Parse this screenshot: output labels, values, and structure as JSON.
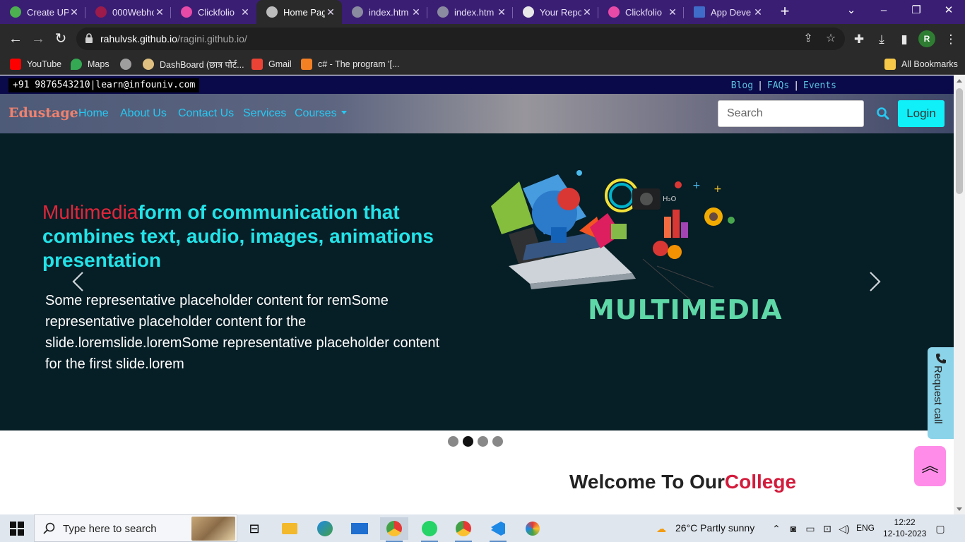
{
  "browser": {
    "tabs": [
      {
        "label": "Create UP",
        "color": "#4caf50"
      },
      {
        "label": "000Webho",
        "color": "#9c1b4a"
      },
      {
        "label": "Clickfolio",
        "color": "#e84aa8"
      },
      {
        "label": "Home Pag",
        "color": "#bdbdbd",
        "active": true
      },
      {
        "label": "index.htm",
        "color": "#8a8aa0"
      },
      {
        "label": "index.htm",
        "color": "#8a8aa0"
      },
      {
        "label": "Your Repo",
        "color": "#e8e8e8"
      },
      {
        "label": "Clickfolio",
        "color": "#e84aa8"
      },
      {
        "label": "App Deve",
        "color": "#3e6cc8"
      }
    ],
    "url_host": "rahulvsk.github.io",
    "url_path": "/ragini.github.io/",
    "profile_initial": "R",
    "bookmarks": [
      {
        "label": "YouTube",
        "color": "#ff0000"
      },
      {
        "label": "Maps",
        "color": "#34a853"
      },
      {
        "label": "",
        "color": "#9e9e9e"
      },
      {
        "label": "DashBoard (छात्र पोर्ट...",
        "color": "#e0c080"
      },
      {
        "label": "Gmail",
        "color": "#ea4335"
      },
      {
        "label": "c# - The program '[...",
        "color": "#f48024"
      }
    ],
    "all_bookmarks": "All Bookmarks"
  },
  "site": {
    "contact": "+91 9876543210|learn@infouniv.com",
    "top_links": [
      "Blog",
      "FAQs",
      "Events"
    ],
    "brand": "Edustage",
    "nav": [
      "Home",
      "About Us",
      "Contact Us",
      "Services",
      "Courses"
    ],
    "search_placeholder": "Search",
    "login": "Login",
    "hero": {
      "title_accent": "Multimedia",
      "title_rest": "form of communication that combines text, audio, images, animations presentation",
      "body": "Some representative placeholder content for remSome representative placeholder content for the slide.loremslide.loremSome representative placeholder content for the first slide.lorem",
      "image_caption": "MULTIMEDIA",
      "slides": 4,
      "active_slide": 1
    },
    "welcome_plain": "Welcome To Our",
    "welcome_accent": "College",
    "request_call": "Request call"
  },
  "taskbar": {
    "search_placeholder": "Type here to search",
    "weather": "26°C  Partly sunny",
    "language": "ENG",
    "time": "12:22",
    "date": "12-10-2023"
  },
  "colors": {
    "cyan": "#23e3e8",
    "accent_red": "#e3263a",
    "hero_bg": "#061e26",
    "brand": "#f0826e"
  }
}
